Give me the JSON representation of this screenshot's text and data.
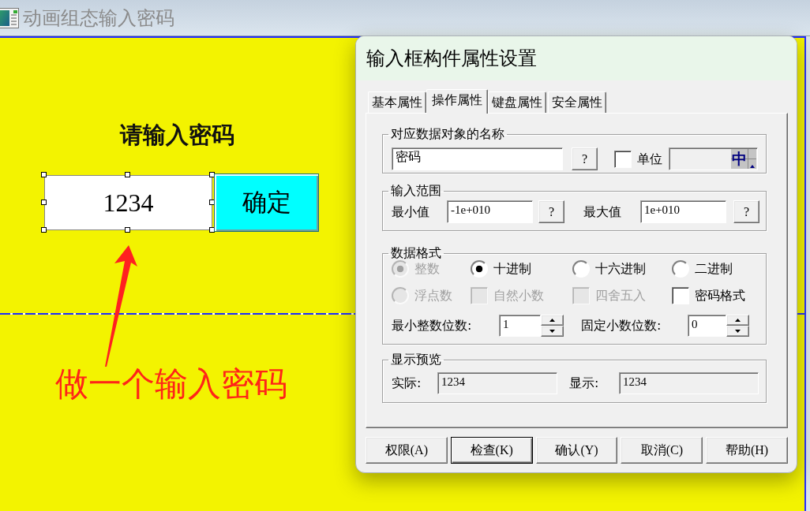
{
  "window": {
    "title": "动画组态输入密码"
  },
  "canvas": {
    "prompt": "请输入密码",
    "password_field": {
      "value": "1234",
      "selected": true
    },
    "confirm_button": "确定",
    "annotation": "做一个输入密码"
  },
  "dialog": {
    "title": "输入框构件属性设置",
    "tabs": [
      {
        "label": "基本属性",
        "selected": false
      },
      {
        "label": "操作属性",
        "selected": true
      },
      {
        "label": "键盘属性",
        "selected": false
      },
      {
        "label": "安全属性",
        "selected": false
      }
    ],
    "data_object": {
      "legend": "对应数据对象的名称",
      "name": "密码",
      "browse_button": "?",
      "unit_checkbox": {
        "label": "单位",
        "checked": false
      },
      "unit_indicator": "中"
    },
    "input_range": {
      "legend": "输入范围",
      "min": {
        "label": "最小值",
        "value": "-1e+010",
        "button": "?"
      },
      "max": {
        "label": "最大值",
        "value": "1e+010",
        "button": "?"
      }
    },
    "data_format": {
      "legend": "数据格式",
      "number_type": [
        {
          "label": "整数",
          "selected": true,
          "disabled": true
        },
        {
          "label": "浮点数",
          "selected": false,
          "disabled": true
        }
      ],
      "radix": [
        {
          "label": "十进制",
          "selected": true,
          "disabled": false
        },
        {
          "label": "十六进制",
          "selected": false,
          "disabled": false
        },
        {
          "label": "二进制",
          "selected": false,
          "disabled": false
        }
      ],
      "options": [
        {
          "label": "自然小数",
          "checked": false,
          "disabled": true
        },
        {
          "label": "四舍五入",
          "checked": false,
          "disabled": true
        },
        {
          "label": "密码格式",
          "checked": false,
          "disabled": false
        }
      ],
      "min_integer_digits": {
        "label": "最小整数位数:",
        "value": "1"
      },
      "fixed_decimal_digits": {
        "label": "固定小数位数:",
        "value": "0"
      }
    },
    "preview": {
      "legend": "显示预览",
      "actual": {
        "label": "实际:",
        "value": "1234"
      },
      "display": {
        "label": "显示:",
        "value": "1234"
      }
    },
    "buttons": [
      {
        "label": "权限(A)",
        "default": false
      },
      {
        "label": "检查(K)",
        "default": true
      },
      {
        "label": "确认(Y)",
        "default": false
      },
      {
        "label": "取消(C)",
        "default": false
      },
      {
        "label": "帮助(H)",
        "default": false
      }
    ]
  }
}
